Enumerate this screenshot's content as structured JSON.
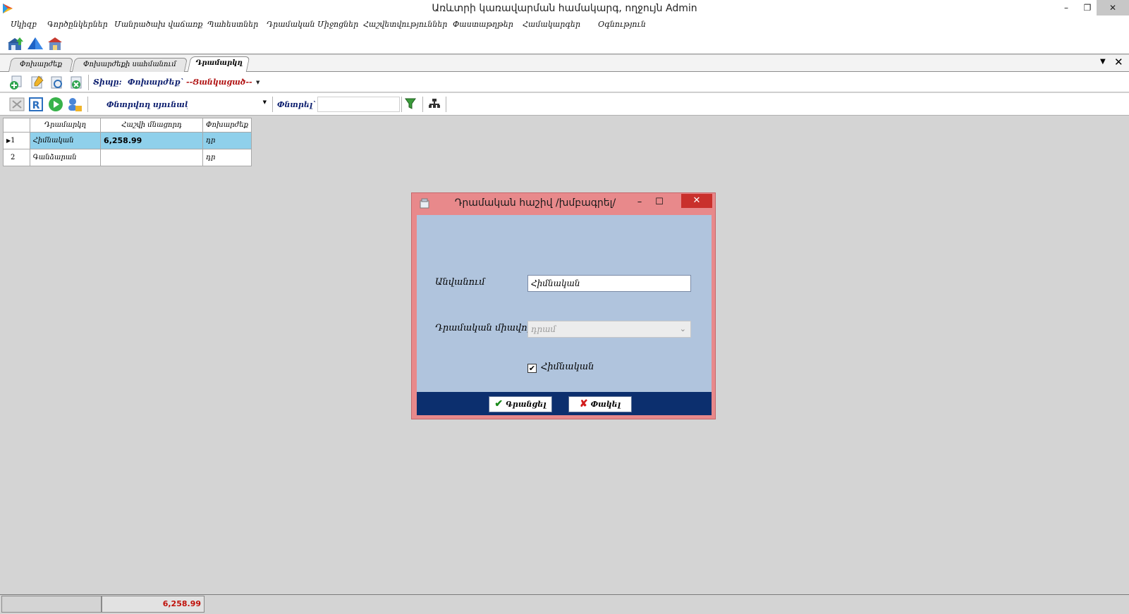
{
  "window": {
    "title": "Առևտրի կառավարման համակարգ, ողջույն Admin",
    "minimize": "–",
    "restore": "❐",
    "close": "✕"
  },
  "menu": [
    "Սկիզբ",
    "Գործընկերներ",
    "Մանրածախ վաճառք",
    "Պահեստներ",
    "Դրամական Միջոցներ",
    "Հաշվետվություններ",
    "Փաստաթղթեր",
    "Համակարգեր",
    "Օգնություն"
  ],
  "tabs": [
    {
      "label": "Փոխարժեք",
      "active": false
    },
    {
      "label": "Փոխարժեքի սահմանում",
      "active": false
    },
    {
      "label": "Դրամարկղ",
      "active": true
    }
  ],
  "toolbar2": {
    "type_label": "Տիպը:",
    "type_value": "Փոխարժեք`",
    "filter_value": "--Ցանկացած--",
    "dropdown": "▼"
  },
  "toolbar3": {
    "search_column_label": "Փնտրվող սյունակ`",
    "search_label": "Փնտրել`",
    "search_value": ""
  },
  "grid": {
    "columns": [
      "Դրամարկղ",
      "Հաշվի մնացորդ",
      "Փոխարժեք"
    ],
    "rows": [
      {
        "num": "1",
        "cashbox": "Հիմնական",
        "balance": "6,258.99",
        "currency": "դր",
        "selected": true
      },
      {
        "num": "2",
        "cashbox": "Գանձարան",
        "balance": "",
        "currency": "դր",
        "selected": false
      }
    ]
  },
  "dialog": {
    "title": "Դրամական հաշիվ /խմբագրել/",
    "minimize": "–",
    "maximize": "☐",
    "close": "✕",
    "name_label": "Անվանում",
    "name_value": "Հիմնական",
    "unit_label": "Դրամական միավոր",
    "unit_value": "դրամ",
    "main_checkbox_label": "Հիմնական",
    "main_checked": "✔",
    "save_label": "Գրանցել",
    "cancel_label": "Փակել"
  },
  "status": {
    "total": "6,258.99"
  },
  "colors": {
    "selected_row": "#8fd0eb",
    "dialog_frame": "#e8898b",
    "dialog_body": "#b0c4dd",
    "dialog_footer": "#0c2f6e",
    "status_total": "#c0120c"
  }
}
